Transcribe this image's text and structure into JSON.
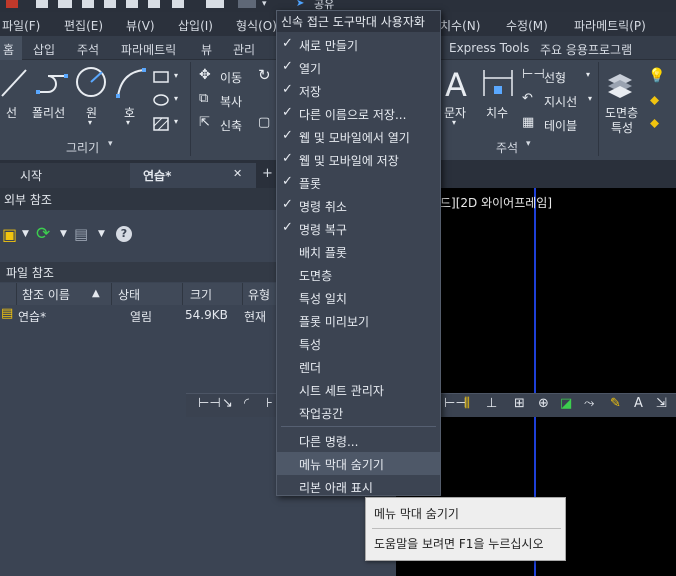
{
  "quick_access": {
    "share_label": "공유"
  },
  "menubar": {
    "items": [
      "파일(F)",
      "편집(E)",
      "뷰(V)",
      "삽입(I)",
      "형식(O)",
      "치수(N)",
      "수정(M)",
      "파라메트릭(P)"
    ]
  },
  "ribbon_tabs": {
    "items": [
      "홈",
      "삽입",
      "주석",
      "파라메트릭",
      "뷰",
      "관리",
      "Express Tools",
      "주요 응용프로그램"
    ]
  },
  "ribbon": {
    "draw": {
      "line": "선",
      "polyline": "폴리선",
      "circle": "원",
      "arc": "호",
      "panel_title": "그리기"
    },
    "modify": {
      "move": "이동",
      "copy": "복사",
      "stretch": "신축"
    },
    "annotation": {
      "text": "문자",
      "dimension": "치수",
      "linear": "선형",
      "leader": "지시선",
      "table": "테이블",
      "panel_title": "주석"
    },
    "layers": {
      "properties_line1": "도면층",
      "properties_line2": "특성"
    }
  },
  "file_tabs": {
    "start": "시작",
    "active": "연습*",
    "close_glyph": "✕"
  },
  "xref_palette": {
    "title": "외부 참조",
    "section": "파일 참조",
    "columns": [
      "참조 이름",
      "상태",
      "크기",
      "유형"
    ],
    "rows": [
      {
        "name": "연습*",
        "status": "열림",
        "size": "54.9KB",
        "type": "현재"
      }
    ]
  },
  "canvas": {
    "viewport_label": "드][2D 와이어프레임]"
  },
  "dropdown": {
    "header": "신속 접근 도구막대 사용자화",
    "items": [
      {
        "label": "새로 만들기",
        "checked": "✓"
      },
      {
        "label": "열기",
        "checked": "✓"
      },
      {
        "label": "저장",
        "checked": "✓"
      },
      {
        "label": "다른 이름으로 저장...",
        "checked": "✓"
      },
      {
        "label": "웹 및 모바일에서 열기",
        "checked": "✓"
      },
      {
        "label": "웹 및 모바일에 저장",
        "checked": "✓"
      },
      {
        "label": "플롯",
        "checked": "✓"
      },
      {
        "label": "명령 취소",
        "checked": "✓"
      },
      {
        "label": "명령 복구",
        "checked": "✓"
      },
      {
        "label": "배치 플롯",
        "checked": ""
      },
      {
        "label": "도면층",
        "checked": ""
      },
      {
        "label": "특성 일치",
        "checked": ""
      },
      {
        "label": "플롯 미리보기",
        "checked": ""
      },
      {
        "label": "특성",
        "checked": ""
      },
      {
        "label": "렌더",
        "checked": ""
      },
      {
        "label": "시트 세트 관리자",
        "checked": ""
      },
      {
        "label": "작업공간",
        "checked": ""
      }
    ],
    "more_commands": "다른 명령...",
    "hide_menubar": "메뉴 막대 숨기기",
    "show_below_ribbon": "리본 아래 표시"
  },
  "tooltip": {
    "title": "메뉴 막대 숨기기",
    "help": "도움말을 보려면 F1을 누르십시오"
  },
  "colors": {
    "canvas": "#000000",
    "viewport_line": "#1e40d8",
    "menu_bg": "#3c4452",
    "ribbon_bg": "#3d4654"
  }
}
